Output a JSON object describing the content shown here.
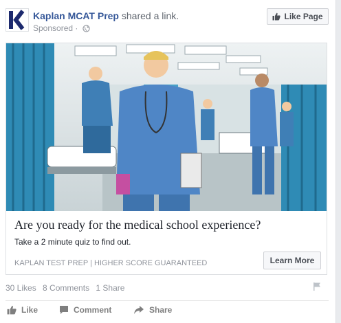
{
  "post": {
    "page_name": "Kaplan MCAT Prep",
    "action_text": "shared a link.",
    "sponsored": "Sponsored",
    "like_page_label": "Like Page",
    "logo_letter": "K"
  },
  "ad": {
    "headline": "Are you ready for the medical school experience?",
    "description": "Take a 2 minute quiz to find out.",
    "domain": "KAPLAN TEST PREP | HIGHER SCORE GUARANTEED",
    "cta_label": "Learn More"
  },
  "stats": {
    "likes": "30 Likes",
    "comments": "8 Comments",
    "shares": "1 Share"
  },
  "actions": {
    "like": "Like",
    "comment": "Comment",
    "share": "Share"
  },
  "colors": {
    "link": "#365899",
    "logo": "#1d2a6e",
    "scrub": "#4f86c6",
    "curtain": "#2f8bb5"
  },
  "icons": [
    "globe-icon",
    "thumbs-up-icon",
    "flag-icon",
    "comment-icon",
    "share-icon"
  ]
}
